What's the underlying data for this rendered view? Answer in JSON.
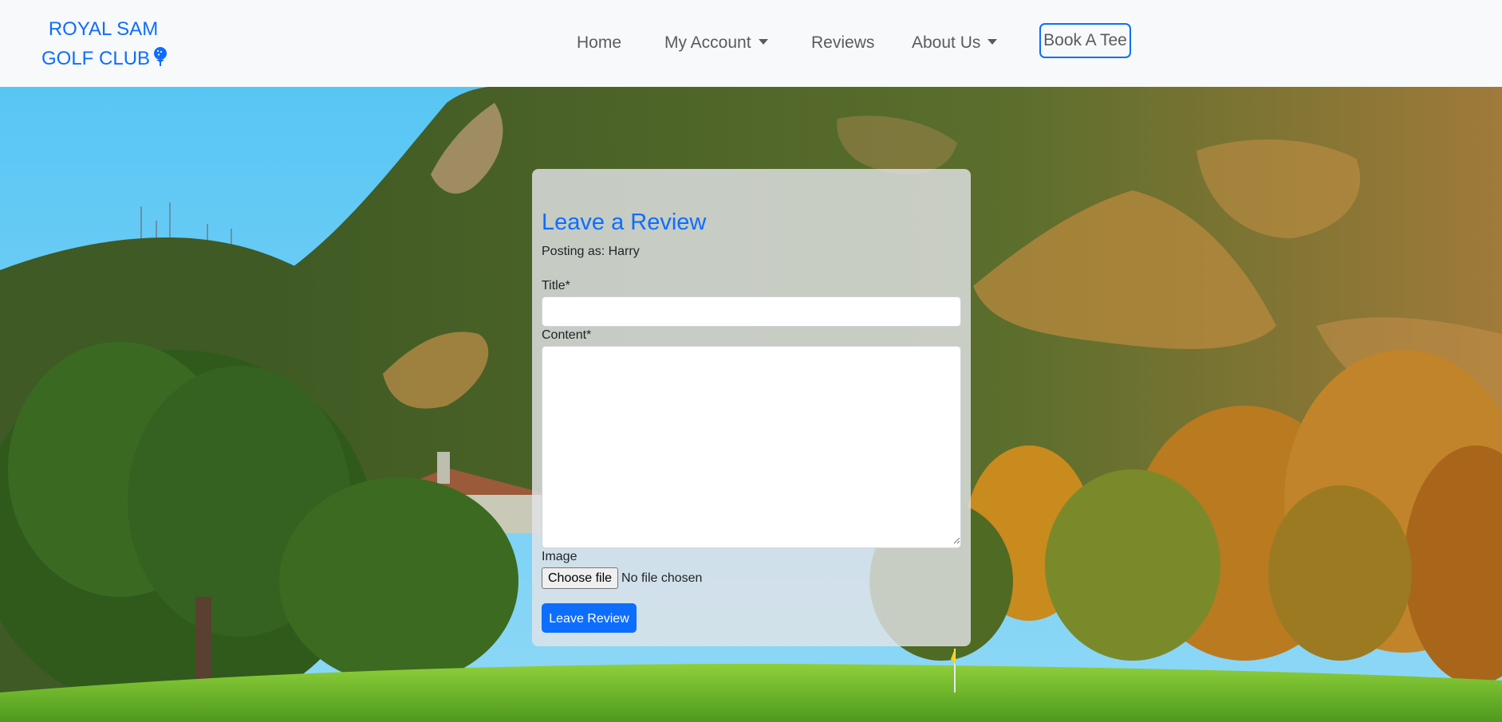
{
  "brand": {
    "line1": "ROYAL SAM",
    "line2": "GOLF CLUB",
    "icon": "golf-ball-tee-icon",
    "color": "#0d6efd"
  },
  "nav": {
    "home": "Home",
    "my_account": "My Account",
    "reviews": "Reviews",
    "about_us": "About Us",
    "book": "Book A Tee"
  },
  "form": {
    "heading": "Leave a Review",
    "posting_as": "Posting as: Harry",
    "title_label": "Title*",
    "title_value": "",
    "content_label": "Content*",
    "content_value": "",
    "image_label": "Image",
    "choose_file": "Choose file",
    "file_status": "No file chosen",
    "submit": "Leave Review"
  },
  "colors": {
    "accent": "#0d6efd",
    "navbar_bg": "#f8f9fa",
    "nav_text": "#595c5f"
  },
  "background": {
    "description_icon": "golf-course-mountain-scene"
  }
}
